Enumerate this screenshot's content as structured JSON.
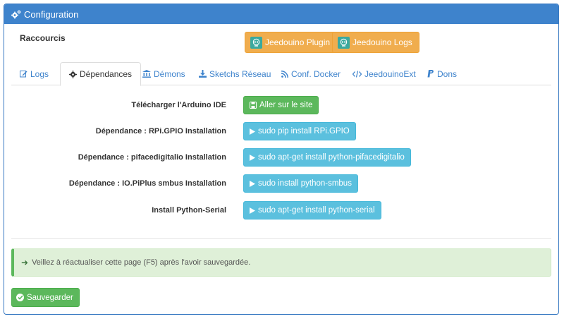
{
  "panel": {
    "title": "Configuration",
    "header_color": "#3e83cc"
  },
  "shortcuts": {
    "label": "Raccourcis",
    "buttons": [
      {
        "label": "Jeedouino Plugin",
        "icon": "jeedouino-logo-icon"
      },
      {
        "label": "Jeedouino Logs",
        "icon": "jeedouino-logo-icon"
      }
    ]
  },
  "tabs": [
    {
      "label": "Logs",
      "icon": "edit-icon",
      "active": false
    },
    {
      "label": "Dépendances",
      "icon": "cog-icon",
      "active": true
    },
    {
      "label": "Démons",
      "icon": "bank-icon",
      "active": false
    },
    {
      "label": "Sketchs Réseau",
      "icon": "download-icon",
      "active": false
    },
    {
      "label": "Conf. Docker",
      "icon": "rss-icon",
      "active": false
    },
    {
      "label": "JeedouinoExt",
      "icon": "code-icon",
      "active": false
    },
    {
      "label": "Dons",
      "icon": "paypal-icon",
      "active": false
    }
  ],
  "dependencies": [
    {
      "label": "Télécharger l'Arduino IDE",
      "button": "Aller sur le site",
      "style": "success",
      "icon": "save-icon"
    },
    {
      "label": "Dépendance : RPi.GPIO Installation",
      "button": "sudo pip install RPi.GPIO",
      "style": "info",
      "icon": "play-icon"
    },
    {
      "label": "Dépendance : pifacedigitalio Installation",
      "button": "sudo apt-get install python-pifacedigitalio",
      "style": "info",
      "icon": "play-icon"
    },
    {
      "label": "Dépendance : IO.PiPlus smbus Installation",
      "button": "sudo install python-smbus",
      "style": "info",
      "icon": "play-icon"
    },
    {
      "label": "Install Python-Serial",
      "button": "sudo apt-get install python-serial",
      "style": "info",
      "icon": "play-icon"
    }
  ],
  "alert": {
    "text": "Veillez à réactualiser cette page (F5) après l'avoir sauvegardée.",
    "icon": "arrow-right-icon"
  },
  "save": {
    "label": "Sauvegarder",
    "icon": "check-circle-icon"
  }
}
